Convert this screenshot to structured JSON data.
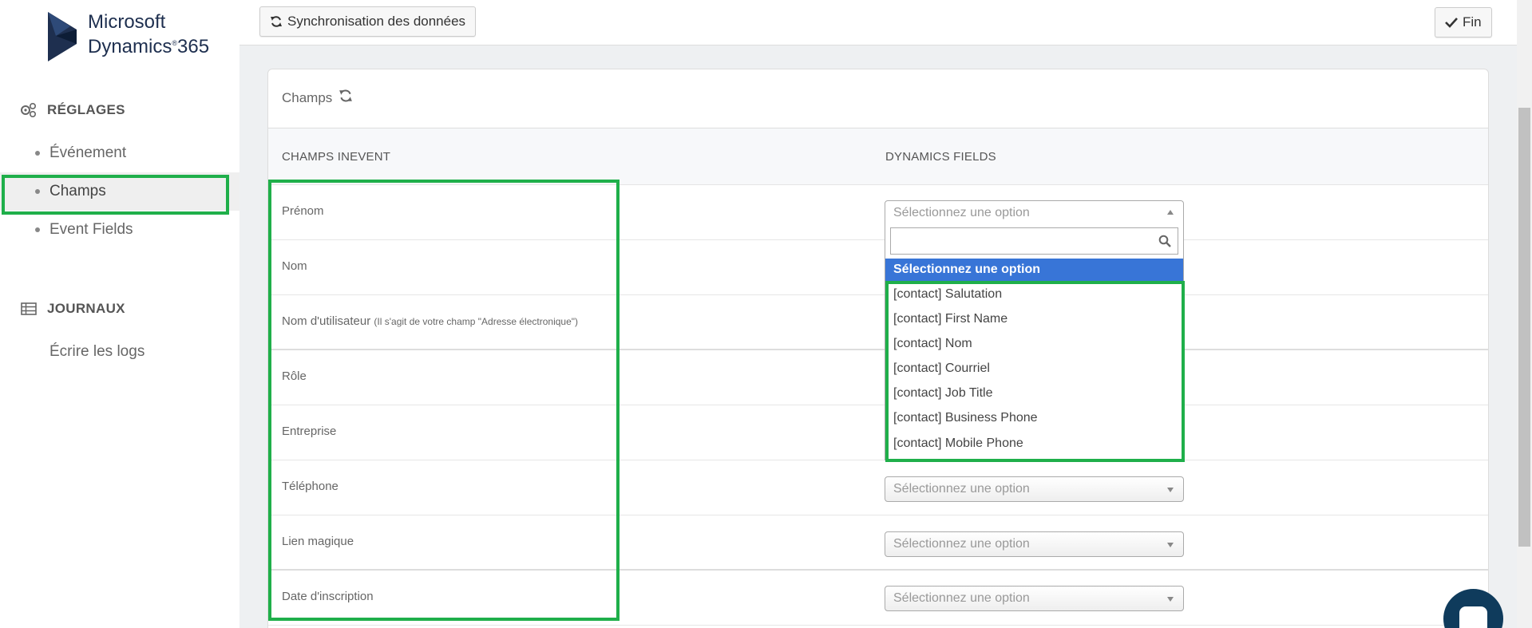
{
  "brand": {
    "line1": "Microsoft",
    "line2": "Dynamics",
    "reg": "®",
    "line2b": "365",
    "color": "#1e2f4f"
  },
  "sidebar": {
    "settings_label": "RÉGLAGES",
    "settings_items": [
      {
        "label": "Événement"
      },
      {
        "label": "Champs",
        "active": true
      },
      {
        "label": "Event Fields"
      }
    ],
    "logs_label": "JOURNAUX",
    "logs_items": [
      {
        "label": "Écrire les logs"
      }
    ]
  },
  "toolbar": {
    "sync_label": "Synchronisation des données",
    "done_label": "Fin"
  },
  "card": {
    "title": "Champs",
    "col_inevent": "CHAMPS INEVENT",
    "col_dynamics": "DYNAMICS FIELDS",
    "rows": [
      {
        "label": "Prénom",
        "note": "",
        "select": "Sélectionnez une option"
      },
      {
        "label": "Nom",
        "note": "",
        "select": ""
      },
      {
        "label": "Nom d'utilisateur",
        "note": "(Il s'agit de votre champ \"Adresse électronique\")",
        "select": ""
      },
      {
        "label": "Rôle",
        "note": "",
        "select": ""
      },
      {
        "label": "Entreprise",
        "note": "",
        "select": ""
      },
      {
        "label": "Téléphone",
        "note": "",
        "select": "Sélectionnez une option"
      },
      {
        "label": "Lien magique",
        "note": "",
        "select": "Sélectionnez une option"
      },
      {
        "label": "Date d'inscription",
        "note": "",
        "select": "Sélectionnez une option"
      }
    ]
  },
  "dropdown": {
    "search_placeholder": "",
    "selected": "Sélectionnez une option",
    "options": [
      "[contact] Salutation",
      "[contact] First Name",
      "[contact] Nom",
      "[contact] Courriel",
      "[contact] Job Title",
      "[contact] Business Phone",
      "[contact] Mobile Phone"
    ]
  },
  "colors": {
    "highlight": "#1faf4a",
    "selected_option": "#3875d7",
    "chat": "#0f3b5c"
  }
}
